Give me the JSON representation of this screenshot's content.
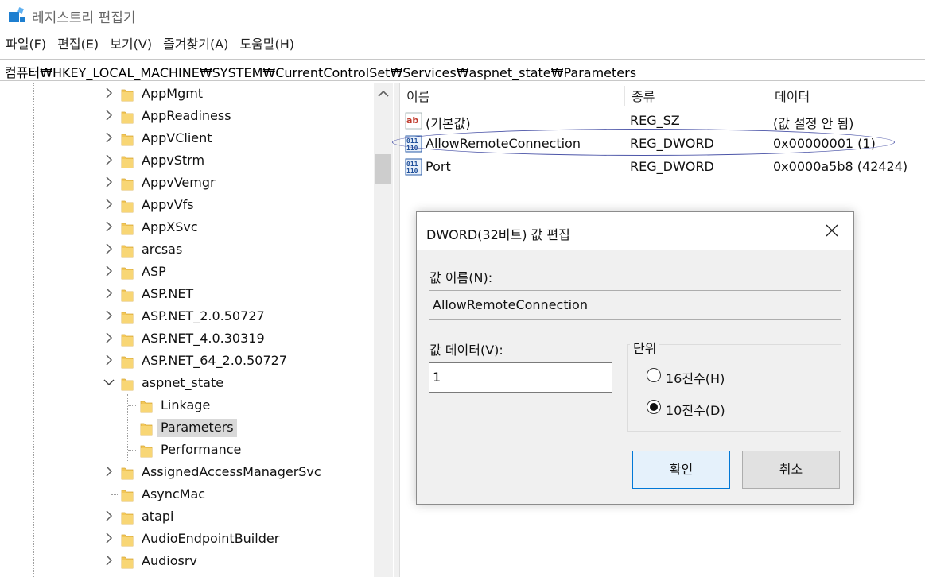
{
  "window": {
    "title": "레지스트리 편집기"
  },
  "menu": [
    "파일(F)",
    "편집(E)",
    "보기(V)",
    "즐겨찾기(A)",
    "도움말(H)"
  ],
  "address": "컴퓨터₩HKEY_LOCAL_MACHINE₩SYSTEM₩CurrentControlSet₩Services₩aspnet_state₩Parameters",
  "tree": {
    "items": [
      {
        "label": "AppMgmt",
        "expander": "collapsed"
      },
      {
        "label": "AppReadiness",
        "expander": "collapsed"
      },
      {
        "label": "AppVClient",
        "expander": "collapsed"
      },
      {
        "label": "AppvStrm",
        "expander": "collapsed"
      },
      {
        "label": "AppvVemgr",
        "expander": "collapsed"
      },
      {
        "label": "AppvVfs",
        "expander": "collapsed"
      },
      {
        "label": "AppXSvc",
        "expander": "collapsed"
      },
      {
        "label": "arcsas",
        "expander": "collapsed"
      },
      {
        "label": "ASP",
        "expander": "collapsed"
      },
      {
        "label": "ASP.NET",
        "expander": "collapsed"
      },
      {
        "label": "ASP.NET_2.0.50727",
        "expander": "collapsed"
      },
      {
        "label": "ASP.NET_4.0.30319",
        "expander": "collapsed"
      },
      {
        "label": "ASP.NET_64_2.0.50727",
        "expander": "collapsed"
      },
      {
        "label": "aspnet_state",
        "expander": "expanded"
      },
      {
        "label": "Linkage",
        "expander": "none",
        "child": true
      },
      {
        "label": "Parameters",
        "expander": "none",
        "child": true,
        "selected": true
      },
      {
        "label": "Performance",
        "expander": "none",
        "child": true
      },
      {
        "label": "AssignedAccessManagerSvc",
        "expander": "collapsed"
      },
      {
        "label": "AsyncMac",
        "expander": "none"
      },
      {
        "label": "atapi",
        "expander": "collapsed"
      },
      {
        "label": "AudioEndpointBuilder",
        "expander": "collapsed"
      },
      {
        "label": "Audiosrv",
        "expander": "collapsed"
      }
    ]
  },
  "list": {
    "columns": [
      "이름",
      "종류",
      "데이터"
    ],
    "rows": [
      {
        "icon": "string-value-icon",
        "name": "(기본값)",
        "type": "REG_SZ",
        "data": "(값 설정 안 됨)"
      },
      {
        "icon": "binary-value-icon",
        "name": "AllowRemoteConnection",
        "type": "REG_DWORD",
        "data": "0x00000001 (1)"
      },
      {
        "icon": "binary-value-icon",
        "name": "Port",
        "type": "REG_DWORD",
        "data": "0x0000a5b8 (42424)"
      }
    ]
  },
  "dialog": {
    "title": "DWORD(32비트) 값 편집",
    "value_name_label": "값 이름(N):",
    "value_name": "AllowRemoteConnection",
    "value_data_label": "값 데이터(V):",
    "value_data": "1",
    "base_label": "단위",
    "radio_hex": "16진수(H)",
    "radio_dec": "10진수(D)",
    "selected_base": "10진수(D)",
    "ok_label": "확인",
    "cancel_label": "취소"
  },
  "colors": {
    "folder": "#f3c758",
    "selection": "#d9d9d9",
    "ok_border": "#0078d7",
    "annotation": "#4c55a8"
  }
}
